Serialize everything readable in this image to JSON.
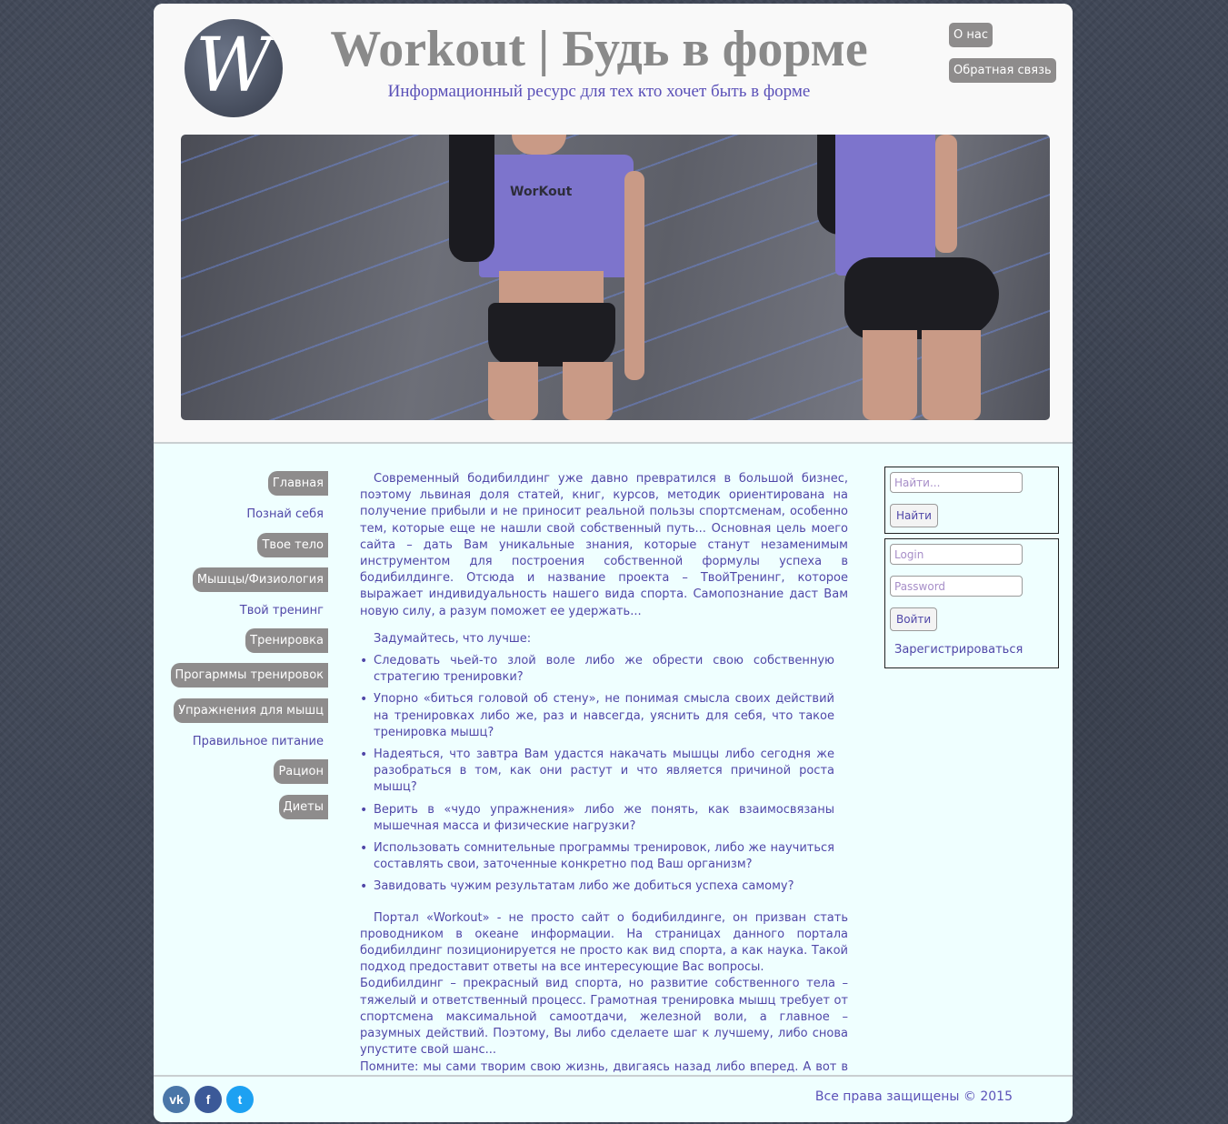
{
  "header": {
    "logo_letter": "W",
    "title": "Workout | Будь в форме",
    "subtitle": "Информационный ресурс для тех кто хочет быть в форме",
    "buttons": [
      "О нас",
      "Обратная связь"
    ]
  },
  "banner": {
    "shirt_text": "WorKout"
  },
  "nav": {
    "items": [
      {
        "label": "Главная"
      },
      {
        "label": "Познай себя"
      },
      {
        "label": "Твое тело"
      },
      {
        "label": "Мышцы/Физиология"
      },
      {
        "label": "Твой тренинг"
      },
      {
        "label": "Тренировка"
      },
      {
        "label": "Прогарммы тренировок"
      },
      {
        "label": "Упражнения для мышц"
      },
      {
        "label": "Правильное питание"
      },
      {
        "label": "Рацион"
      },
      {
        "label": "Диеты"
      }
    ]
  },
  "content": {
    "intro": "Современный бодибилдинг уже давно превратился в большой бизнес, поэтому львиная доля статей, книг, курсов, методик ориентирована на получение прибыли и не приносит реальной пользы спортсменам, особенно тем, которые еще не нашли свой собственный путь... Основная цель моего сайта – дать Вам уникальные знания, которые станут незаменимым инструментом для построения собственной формулы успеха в бодибилдинге. Отсюда и название проекта – ТвойТренинг, которое выражает индивидуальность нашего вида спорта. Самопознание даст Вам новую силу, а разум поможет ее удержать...",
    "question": "Задумайтесь, что лучше:",
    "bullets": [
      "Следовать чьей-то злой воле либо же обрести свою собственную стратегию тренировки?",
      "Упорно «биться головой об стену», не понимая смысла своих действий на тренировках либо же, раз и навсегда, уяснить для себя, что такое тренировка мышц?",
      "Надеяться, что завтра Вам удастся накачать мышцы либо сегодня же разобраться в том, как они растут и что является причиной роста мышц?",
      "Верить в «чудо упражнения» либо же понять, как взаимосвязаны мышечная масса и физические нагрузки?",
      "Использовать сомнительные программы тренировок, либо же научиться составлять свои, заточенные конкретно под Ваш организм?",
      "Завидовать чужим результатам либо же добиться успеха самому?"
    ],
    "outro1": "Портал «Workout» - не просто сайт о бодибилдинге, он призван стать проводником в океане информации. На страницах данного портала бодибилдинг позиционируется не просто как вид спорта, а как наука. Такой подход предоставит ответы на все интересующие Вас вопросы.",
    "outro2": "Бодибилдинг – прекрасный вид спорта, но развитие собственного тела – тяжелый и ответственный процесс. Грамотная тренировка мышц требует от спортсмена максимальной самоотдачи, железной воли, а главное – разумных действий. Поэтому, Вы либо сделаете шаг к лучшему, либо снова упустите свой шанс...",
    "outro3": "Помните: мы сами творим свою жизнь, двигаясь назад либо вперед. А вот в какую сторону шагнуть сейчас – решать Вам, у каждого свой путь!"
  },
  "search": {
    "placeholder": "Найти...",
    "button": "Найти"
  },
  "login": {
    "login_placeholder": "Login",
    "password_placeholder": "Password",
    "button": "Войти",
    "register": "Зарегистрироваться"
  },
  "footer": {
    "social": [
      "vk-icon",
      "facebook-icon",
      "twitter-icon"
    ],
    "social_glyphs": [
      "vk",
      "f",
      "t"
    ],
    "copyright": "Все права защищены © 2015"
  }
}
